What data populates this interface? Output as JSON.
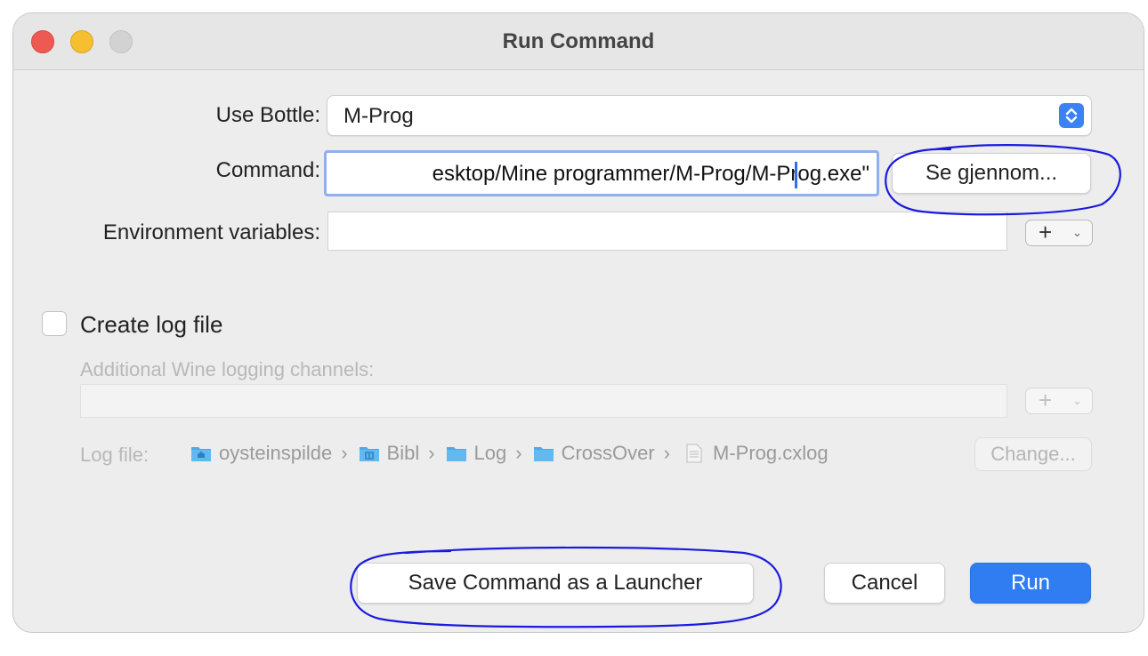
{
  "window": {
    "title": "Run Command"
  },
  "form": {
    "bottle_label": "Use Bottle:",
    "bottle_value": "M-Prog",
    "command_label": "Command:",
    "command_value": "esktop/Mine programmer/M-Prog/M-Prog.exe\"",
    "browse_button": "Se gjennom...",
    "env_label": "Environment variables:",
    "env_value": ""
  },
  "logging": {
    "checkbox_label": "Create log file",
    "checked": false,
    "channels_label": "Additional Wine logging channels:",
    "channels_value": "",
    "log_file_label": "Log file:",
    "path": [
      {
        "label": "oysteinspilde",
        "icon": "home-folder-icon"
      },
      {
        "label": "Bibl",
        "icon": "library-folder-icon"
      },
      {
        "label": "Log",
        "icon": "folder-icon"
      },
      {
        "label": "CrossOver",
        "icon": "folder-icon"
      }
    ],
    "file_name": "M-Prog.cxlog",
    "change_button": "Change..."
  },
  "footer": {
    "save_launcher_button": "Save Command as a Launcher",
    "cancel_button": "Cancel",
    "run_button": "Run"
  },
  "colors": {
    "accent": "#2f7df0",
    "annotation": "#1a1adf",
    "close": "#ee5a52",
    "minimize": "#f5bf2f",
    "folder": "#4fa9e6"
  }
}
